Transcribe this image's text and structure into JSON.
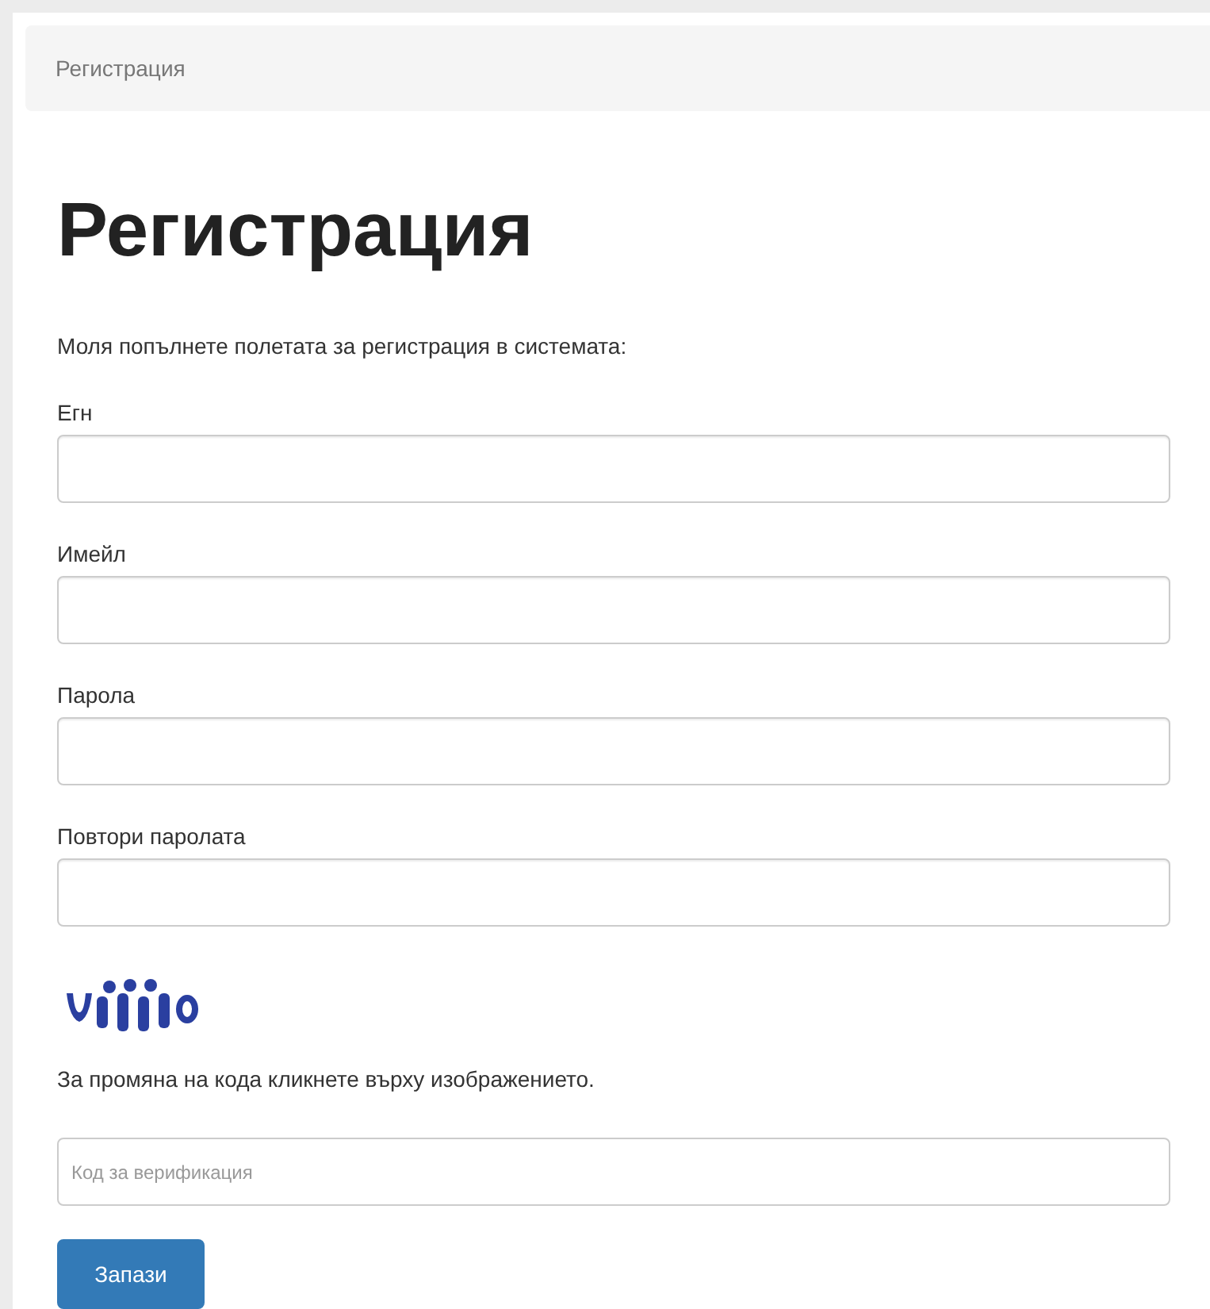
{
  "breadcrumb": "Регистрация",
  "heading": "Регистрация",
  "intro": "Моля попълнете полетата за регистрация в системата:",
  "fields": [
    {
      "label": "Егн"
    },
    {
      "label": "Имейл"
    },
    {
      "label": "Парола"
    },
    {
      "label": "Повтори паролата"
    }
  ],
  "captcha": {
    "kind": "picture",
    "hint": "За промяна на кода кликнете върху изображението."
  },
  "code_field": {
    "placeholder": "Код за верификация"
  },
  "submit_button": "Запази"
}
